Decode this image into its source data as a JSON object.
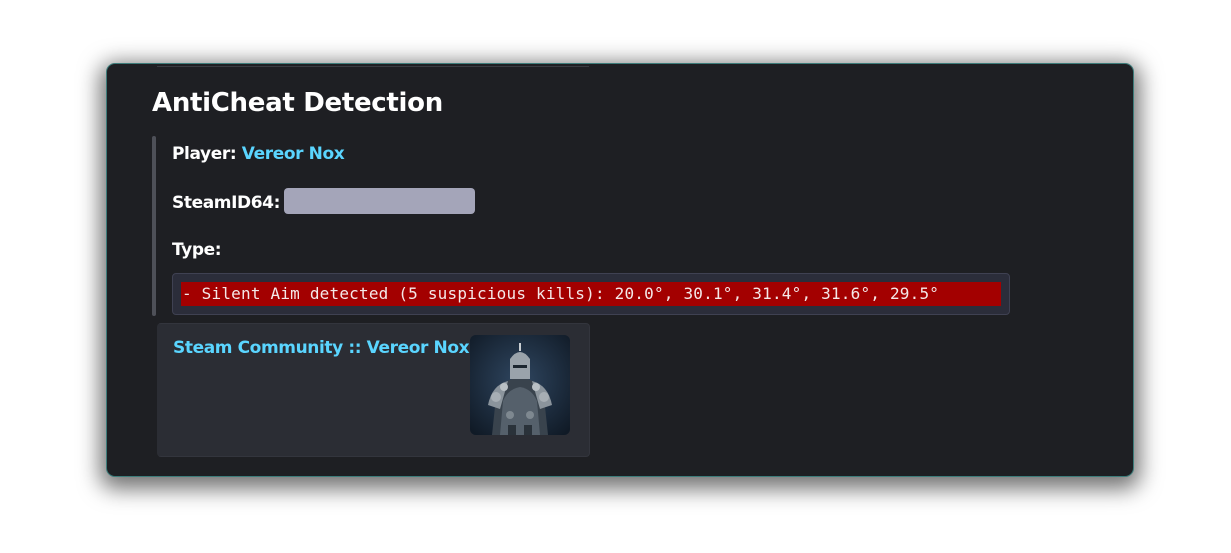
{
  "message": {
    "title": "AntiCheat Detection",
    "player_label": "Player:",
    "player_name": "Vereor Nox",
    "steamid_label": "SteamID64:",
    "type_label": "Type:",
    "detection_text": "- Silent Aim detected (5 suspicious kills): 20.0°, 30.1°, 31.4°, 31.6°, 29.5°"
  },
  "embed": {
    "title": "Steam Community :: Vereor Nox",
    "thumbnail_icon": "knight-avatar-image"
  },
  "colors": {
    "card_bg": "#1e1f23",
    "link": "#5ad5ff",
    "spoiler": "#a4a5b9",
    "highlight": "#a30000"
  }
}
